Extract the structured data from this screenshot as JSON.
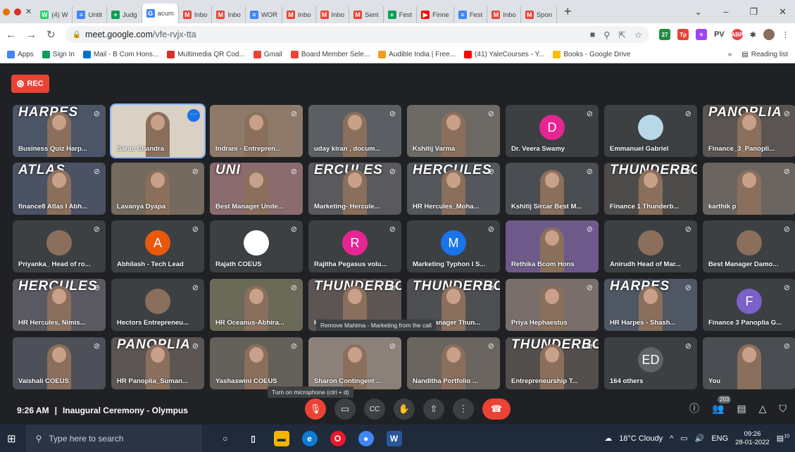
{
  "browser": {
    "tabs": [
      {
        "label": "(4) W",
        "fav": "#25d366",
        "letter": "W"
      },
      {
        "label": "Untit",
        "fav": "#4285f4",
        "letter": "≡"
      },
      {
        "label": "Judg",
        "fav": "#0f9d58",
        "letter": "+"
      },
      {
        "label": "acum",
        "fav": "#4285f4",
        "letter": "G"
      },
      {
        "label": "Inbo",
        "fav": "#ea4335",
        "letter": "M"
      },
      {
        "label": "Inbo",
        "fav": "#ea4335",
        "letter": "M"
      },
      {
        "label": "WOR",
        "fav": "#4285f4",
        "letter": "≡"
      },
      {
        "label": "Inbo",
        "fav": "#ea4335",
        "letter": "M"
      },
      {
        "label": "Inbo",
        "fav": "#ea4335",
        "letter": "M"
      },
      {
        "label": "Sent",
        "fav": "#ea4335",
        "letter": "M"
      },
      {
        "label": "Fest",
        "fav": "#0f9d58",
        "letter": "+"
      },
      {
        "label": "Finne",
        "fav": "#ff0000",
        "letter": "▶"
      },
      {
        "label": "Fest",
        "fav": "#4285f4",
        "letter": "≡"
      },
      {
        "label": "Inbo",
        "fav": "#ea4335",
        "letter": "M"
      },
      {
        "label": "Spon",
        "fav": "#ea4335",
        "letter": "M"
      }
    ],
    "url_host": "meet.google.com",
    "url_path": "/vfe-rvjx-tta",
    "extension_pv": "PV",
    "extension_abp": "ABP",
    "bookmarks": [
      {
        "label": "Apps",
        "color": "#4285f4"
      },
      {
        "label": "Sign In",
        "color": "#0f9d58"
      },
      {
        "label": "Mail - B Com Hons...",
        "color": "#0072c6"
      },
      {
        "label": "Multimedia QR Cod...",
        "color": "#d93025"
      },
      {
        "label": "Gmail",
        "color": "#ea4335"
      },
      {
        "label": "Board Member Sele...",
        "color": "#ea4335"
      },
      {
        "label": "Audible India | Free...",
        "color": "#f29b1d"
      },
      {
        "label": "(41) YaleCourses - Y...",
        "color": "#ff0000"
      },
      {
        "label": "Books - Google Drive",
        "color": "#fbbc04"
      }
    ],
    "bookmarks_overflow": "»",
    "reading_list": "Reading list"
  },
  "meeting": {
    "rec_label": "REC",
    "tiles": [
      {
        "name": "Business Quiz Harp...",
        "banner": "HARPES",
        "bg": "#4b5566"
      },
      {
        "name": "Saras Chandra",
        "bg": "#d9d2c4",
        "selected": true
      },
      {
        "name": "Indrani - Entrepren...",
        "bg": "#8d7a6a"
      },
      {
        "name": "uday kiran , docum...",
        "bg": "#5b5e63"
      },
      {
        "name": "Kshitij Varma",
        "bg": "#6d6a66"
      },
      {
        "name": "Dr. Veera Swamy",
        "avatar": "D",
        "avatar_color": "#e52592",
        "bg": "#3c4043"
      },
      {
        "name": "Emmanuel Gabriel",
        "avatar": "",
        "avatar_color": "#b8d8e8",
        "bg": "#3c4043"
      },
      {
        "name": "Finance_3_Panopli...",
        "banner": "PANOPLIA",
        "bg": "#5a5552"
      },
      {
        "name": "finance8 Atlas I Abh...",
        "banner": "ATLAS",
        "bg": "#4a5263"
      },
      {
        "name": "Lavanya Dyapa",
        "bg": "#756a5f"
      },
      {
        "name": "Best Manager Unde...",
        "banner": "UNI",
        "bg": "#8b6b6e"
      },
      {
        "name": "Marketing- Hercule...",
        "banner": "ERCULES",
        "bg": "#5a5a5e"
      },
      {
        "name": "HR Hercules_Moha...",
        "banner": "HERCULES",
        "bg": "#54575c"
      },
      {
        "name": "Kshitij Sircar Best M...",
        "bg": "#4a4d52"
      },
      {
        "name": "Finance 1 Thunderb...",
        "banner": "THUNDERBOLTS",
        "bg": "#4e4c4a"
      },
      {
        "name": "karthik p",
        "bg": "#6a6560"
      },
      {
        "name": "Priyanka_ Head of ro...",
        "bg": "#3c4043",
        "small": true
      },
      {
        "name": "Abhilash - Tech Lead",
        "avatar": "A",
        "avatar_color": "#e8590c",
        "bg": "#3c4043"
      },
      {
        "name": "Rajath COEUS",
        "avatar": "",
        "avatar_color": "#ffffff",
        "bg": "#3c4043"
      },
      {
        "name": "Rajitha Pegasus volu...",
        "avatar": "R",
        "avatar_color": "#e52592",
        "bg": "#3c4043"
      },
      {
        "name": "Marketing Typhon I S...",
        "avatar": "M",
        "avatar_color": "#1a73e8",
        "bg": "#3c4043"
      },
      {
        "name": "Rethika Bcom Hons",
        "bg": "#6e5a8a"
      },
      {
        "name": "Anirudh Head of Mar...",
        "bg": "#3c4043",
        "small": true
      },
      {
        "name": "Best Manager Damo...",
        "bg": "#3c4043",
        "small": true
      },
      {
        "name": "HR Hercules, Nimis...",
        "banner": "HERCULES",
        "bg": "#5a5962"
      },
      {
        "name": "Hectors Entrepreneu...",
        "bg": "#3c4043",
        "small": true
      },
      {
        "name": "HR Oceanus-Abhira...",
        "bg": "#6b6a58"
      },
      {
        "name": "HR Thunderbolts Sa...",
        "banner": "THUNDERBOLTS",
        "bg": "#5c5553"
      },
      {
        "name": "Best Manager Thun...",
        "banner": "THUNDERBOLTS",
        "bg": "#4e4f53"
      },
      {
        "name": "Priya Hephaestus",
        "bg": "#7a6e6a"
      },
      {
        "name": "HR Harpes - Shash...",
        "banner": "HARPES",
        "bg": "#4f5664"
      },
      {
        "name": "Finance 3 Panoplia G...",
        "avatar": "F",
        "avatar_color": "#7b61c8",
        "bg": "#3c4043"
      },
      {
        "name": "Vaishali COEUS",
        "bg": "#4d5058"
      },
      {
        "name": "HR Panoplia_Suman...",
        "banner": "PANOPLIA",
        "bg": "#5b5653"
      },
      {
        "name": "Yashaswini COEUS",
        "bg": "#64605a"
      },
      {
        "name": "Sharon Contingent ...",
        "bg": "#8b8178"
      },
      {
        "name": "Nanditha Portfolio ...",
        "bg": "#6b6560"
      },
      {
        "name": "Entrepreneurship T...",
        "banner": "THUNDERBOLTS",
        "bg": "#524f4d"
      },
      {
        "name": "164 others",
        "avatar": "ED",
        "avatar_color": "#5f6368",
        "bg": "#3c4043"
      },
      {
        "name": "You",
        "bg": "#4a4d52"
      }
    ],
    "tooltip_remove": "Remove Mahima - Marketing from the call",
    "tooltip_mic": "Turn on microphone (ctrl + d)",
    "time": "9:26 AM",
    "separator": "|",
    "meeting_title": "Inaugural Ceremony - Olympus",
    "participant_count": "203"
  },
  "taskbar": {
    "search_placeholder": "Type here to search",
    "weather": "18°C  Cloudy",
    "lang": "ENG",
    "clock_time": "09:26",
    "clock_date": "28-01-2022",
    "notif_count": "10"
  }
}
